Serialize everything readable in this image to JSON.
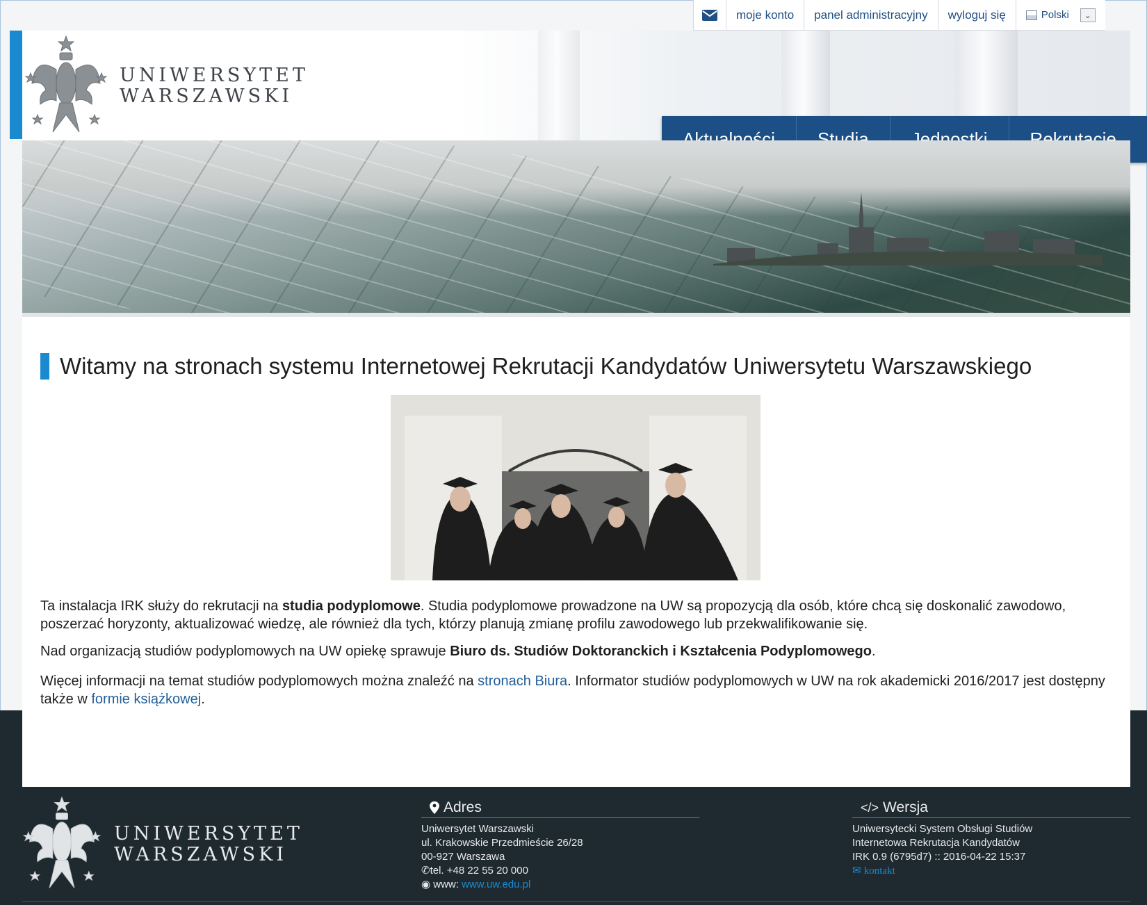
{
  "topbar": {
    "mail_icon": "envelope-icon",
    "account": "moje konto",
    "admin_panel": "panel administracyjny",
    "logout": "wyloguj się",
    "language": "Polski",
    "language_icon": "language-icon",
    "select_icon": "chevron-down-icon"
  },
  "header": {
    "logo_line1": "UNIWERSYTET",
    "logo_line2": "WARSZAWSKI",
    "nav": [
      "Aktualności",
      "Studia",
      "Jednostki",
      "Rekrutacje"
    ]
  },
  "main": {
    "title": "Witamy na stronach systemu Internetowej Rekrutacji Kandydatów Uniwersytetu Warszawskiego",
    "p1_a": "Ta instalacja IRK służy do rekrutacji na ",
    "p1_b": "studia podyplomowe",
    "p1_c": ". Studia podyplomowe prowadzone na UW są propozycją dla osób, które chcą się doskonalić zawodowo, poszerzać horyzonty, aktualizować wiedzę, ale również dla tych, którzy planują zmianę profilu zawodowego lub przekwalifikowanie się.",
    "p2_a": "Nad organizacją studiów podyplomowych na UW opiekę sprawuje ",
    "p2_b": "Biuro ds. Studiów Doktoranckich i Kształcenia Podyplomowego",
    "p2_c": ".",
    "p3_a": "Więcej informacji na temat studiów podyplomowych można znaleźć na ",
    "p3_link1": "stronach Biura",
    "p3_b": ". Informator studiów podyplomowych w UW na rok akademicki 2016/2017 jest dostępny także w ",
    "p3_link2": "formie książkowej",
    "p3_c": "."
  },
  "footer": {
    "logo_line1": "UNIWERSYTET",
    "logo_line2": "WARSZAWSKI",
    "address": {
      "heading": "Adres",
      "icon": "map-marker-icon",
      "line1": "Uniwersytet Warszawski",
      "line2": "ul. Krakowskie Przedmieście 26/28",
      "line3": "00-927 Warszawa",
      "phone_icon": "phone-icon",
      "phone": "tel. +48 22 55 20 000",
      "www_icon": "globe-icon",
      "www_label": "www: ",
      "www_link": "www.uw.edu.pl"
    },
    "version": {
      "heading": "Wersja",
      "icon": "code-icon",
      "line1": "Uniwersytecki System Obsługi Studiów",
      "line2": "Internetowa Rekrutacja Kandydatów",
      "line3": "IRK 0.9 (6795d7) :: 2016-04-22 15:37",
      "contact_icon": "envelope-icon",
      "contact": "kontakt"
    }
  },
  "colors": {
    "accent": "#1a8ad0",
    "nav_bg": "#1b4f86",
    "footer_bg": "#1f2a30",
    "link": "#1f5f9a"
  }
}
